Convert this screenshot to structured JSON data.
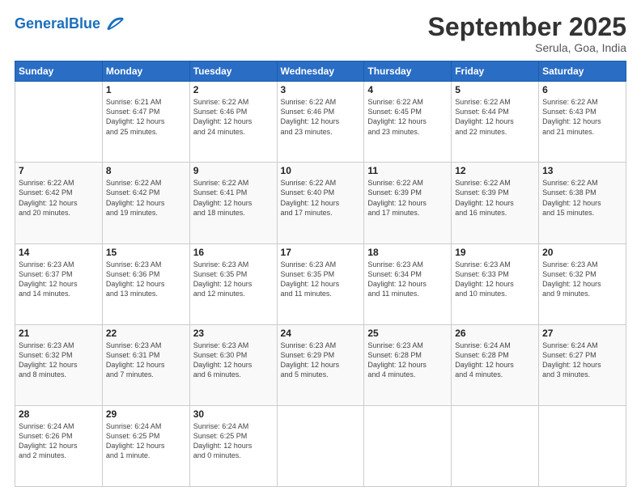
{
  "header": {
    "logo_general": "General",
    "logo_blue": "Blue",
    "month": "September 2025",
    "location": "Serula, Goa, India"
  },
  "days_of_week": [
    "Sunday",
    "Monday",
    "Tuesday",
    "Wednesday",
    "Thursday",
    "Friday",
    "Saturday"
  ],
  "weeks": [
    [
      {
        "day": "",
        "info": ""
      },
      {
        "day": "1",
        "info": "Sunrise: 6:21 AM\nSunset: 6:47 PM\nDaylight: 12 hours\nand 25 minutes."
      },
      {
        "day": "2",
        "info": "Sunrise: 6:22 AM\nSunset: 6:46 PM\nDaylight: 12 hours\nand 24 minutes."
      },
      {
        "day": "3",
        "info": "Sunrise: 6:22 AM\nSunset: 6:46 PM\nDaylight: 12 hours\nand 23 minutes."
      },
      {
        "day": "4",
        "info": "Sunrise: 6:22 AM\nSunset: 6:45 PM\nDaylight: 12 hours\nand 23 minutes."
      },
      {
        "day": "5",
        "info": "Sunrise: 6:22 AM\nSunset: 6:44 PM\nDaylight: 12 hours\nand 22 minutes."
      },
      {
        "day": "6",
        "info": "Sunrise: 6:22 AM\nSunset: 6:43 PM\nDaylight: 12 hours\nand 21 minutes."
      }
    ],
    [
      {
        "day": "7",
        "info": "Sunrise: 6:22 AM\nSunset: 6:42 PM\nDaylight: 12 hours\nand 20 minutes."
      },
      {
        "day": "8",
        "info": "Sunrise: 6:22 AM\nSunset: 6:42 PM\nDaylight: 12 hours\nand 19 minutes."
      },
      {
        "day": "9",
        "info": "Sunrise: 6:22 AM\nSunset: 6:41 PM\nDaylight: 12 hours\nand 18 minutes."
      },
      {
        "day": "10",
        "info": "Sunrise: 6:22 AM\nSunset: 6:40 PM\nDaylight: 12 hours\nand 17 minutes."
      },
      {
        "day": "11",
        "info": "Sunrise: 6:22 AM\nSunset: 6:39 PM\nDaylight: 12 hours\nand 17 minutes."
      },
      {
        "day": "12",
        "info": "Sunrise: 6:22 AM\nSunset: 6:39 PM\nDaylight: 12 hours\nand 16 minutes."
      },
      {
        "day": "13",
        "info": "Sunrise: 6:22 AM\nSunset: 6:38 PM\nDaylight: 12 hours\nand 15 minutes."
      }
    ],
    [
      {
        "day": "14",
        "info": "Sunrise: 6:23 AM\nSunset: 6:37 PM\nDaylight: 12 hours\nand 14 minutes."
      },
      {
        "day": "15",
        "info": "Sunrise: 6:23 AM\nSunset: 6:36 PM\nDaylight: 12 hours\nand 13 minutes."
      },
      {
        "day": "16",
        "info": "Sunrise: 6:23 AM\nSunset: 6:35 PM\nDaylight: 12 hours\nand 12 minutes."
      },
      {
        "day": "17",
        "info": "Sunrise: 6:23 AM\nSunset: 6:35 PM\nDaylight: 12 hours\nand 11 minutes."
      },
      {
        "day": "18",
        "info": "Sunrise: 6:23 AM\nSunset: 6:34 PM\nDaylight: 12 hours\nand 11 minutes."
      },
      {
        "day": "19",
        "info": "Sunrise: 6:23 AM\nSunset: 6:33 PM\nDaylight: 12 hours\nand 10 minutes."
      },
      {
        "day": "20",
        "info": "Sunrise: 6:23 AM\nSunset: 6:32 PM\nDaylight: 12 hours\nand 9 minutes."
      }
    ],
    [
      {
        "day": "21",
        "info": "Sunrise: 6:23 AM\nSunset: 6:32 PM\nDaylight: 12 hours\nand 8 minutes."
      },
      {
        "day": "22",
        "info": "Sunrise: 6:23 AM\nSunset: 6:31 PM\nDaylight: 12 hours\nand 7 minutes."
      },
      {
        "day": "23",
        "info": "Sunrise: 6:23 AM\nSunset: 6:30 PM\nDaylight: 12 hours\nand 6 minutes."
      },
      {
        "day": "24",
        "info": "Sunrise: 6:23 AM\nSunset: 6:29 PM\nDaylight: 12 hours\nand 5 minutes."
      },
      {
        "day": "25",
        "info": "Sunrise: 6:23 AM\nSunset: 6:28 PM\nDaylight: 12 hours\nand 4 minutes."
      },
      {
        "day": "26",
        "info": "Sunrise: 6:24 AM\nSunset: 6:28 PM\nDaylight: 12 hours\nand 4 minutes."
      },
      {
        "day": "27",
        "info": "Sunrise: 6:24 AM\nSunset: 6:27 PM\nDaylight: 12 hours\nand 3 minutes."
      }
    ],
    [
      {
        "day": "28",
        "info": "Sunrise: 6:24 AM\nSunset: 6:26 PM\nDaylight: 12 hours\nand 2 minutes."
      },
      {
        "day": "29",
        "info": "Sunrise: 6:24 AM\nSunset: 6:25 PM\nDaylight: 12 hours\nand 1 minute."
      },
      {
        "day": "30",
        "info": "Sunrise: 6:24 AM\nSunset: 6:25 PM\nDaylight: 12 hours\nand 0 minutes."
      },
      {
        "day": "",
        "info": ""
      },
      {
        "day": "",
        "info": ""
      },
      {
        "day": "",
        "info": ""
      },
      {
        "day": "",
        "info": ""
      }
    ]
  ]
}
